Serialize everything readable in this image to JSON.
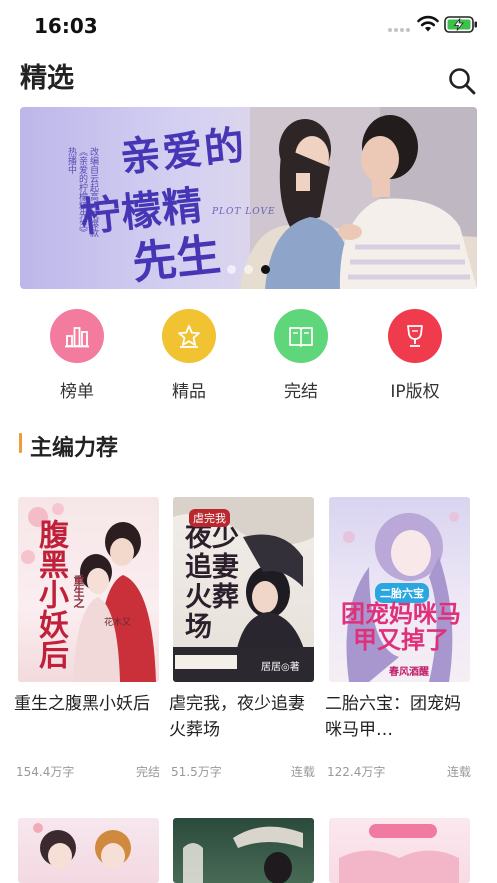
{
  "status_bar": {
    "time": "16:03"
  },
  "header": {
    "title": "精选"
  },
  "banner": {
    "title_line1": "亲爱的",
    "title_line2": "柠檬精",
    "title_line3": "先生",
    "subtitle": "PLOT LOVE",
    "side_text": "改编自云起高人气爆款《亲爱的柠檬精先生》 热播中",
    "active_index": 2
  },
  "categories": [
    {
      "label": "榜单",
      "icon": "chart-icon",
      "color": "#f27b9e"
    },
    {
      "label": "精品",
      "icon": "star-icon",
      "color": "#f1c232"
    },
    {
      "label": "完结",
      "icon": "book-icon",
      "color": "#5fd67a"
    },
    {
      "label": "IP版权",
      "icon": "trophy-icon",
      "color": "#ef3b4b"
    }
  ],
  "section": {
    "title": "主编力荐"
  },
  "books": [
    {
      "title": "重生之腹黑小妖后",
      "words": "154.4万字",
      "status": "完结",
      "cover_text": "腹黑小妖后",
      "cover_sub": "重生之",
      "cover_author": "花木又"
    },
    {
      "title": "虐完我，夜少追妻火葬场",
      "words": "51.5万字",
      "status": "连载",
      "cover_text": "夜少追妻火葬场",
      "cover_sub": "虐完我",
      "cover_author": "居居◎著"
    },
    {
      "title": "二胎六宝：团宠妈咪马甲…",
      "words": "122.4万字",
      "status": "连载",
      "cover_text": "团宠妈咪马甲又掉了",
      "cover_sub": "二胎六宝",
      "cover_author": "春风酒醒"
    }
  ],
  "colors": {
    "accent": "#f09a3e",
    "banner_title": "#4636b5"
  }
}
